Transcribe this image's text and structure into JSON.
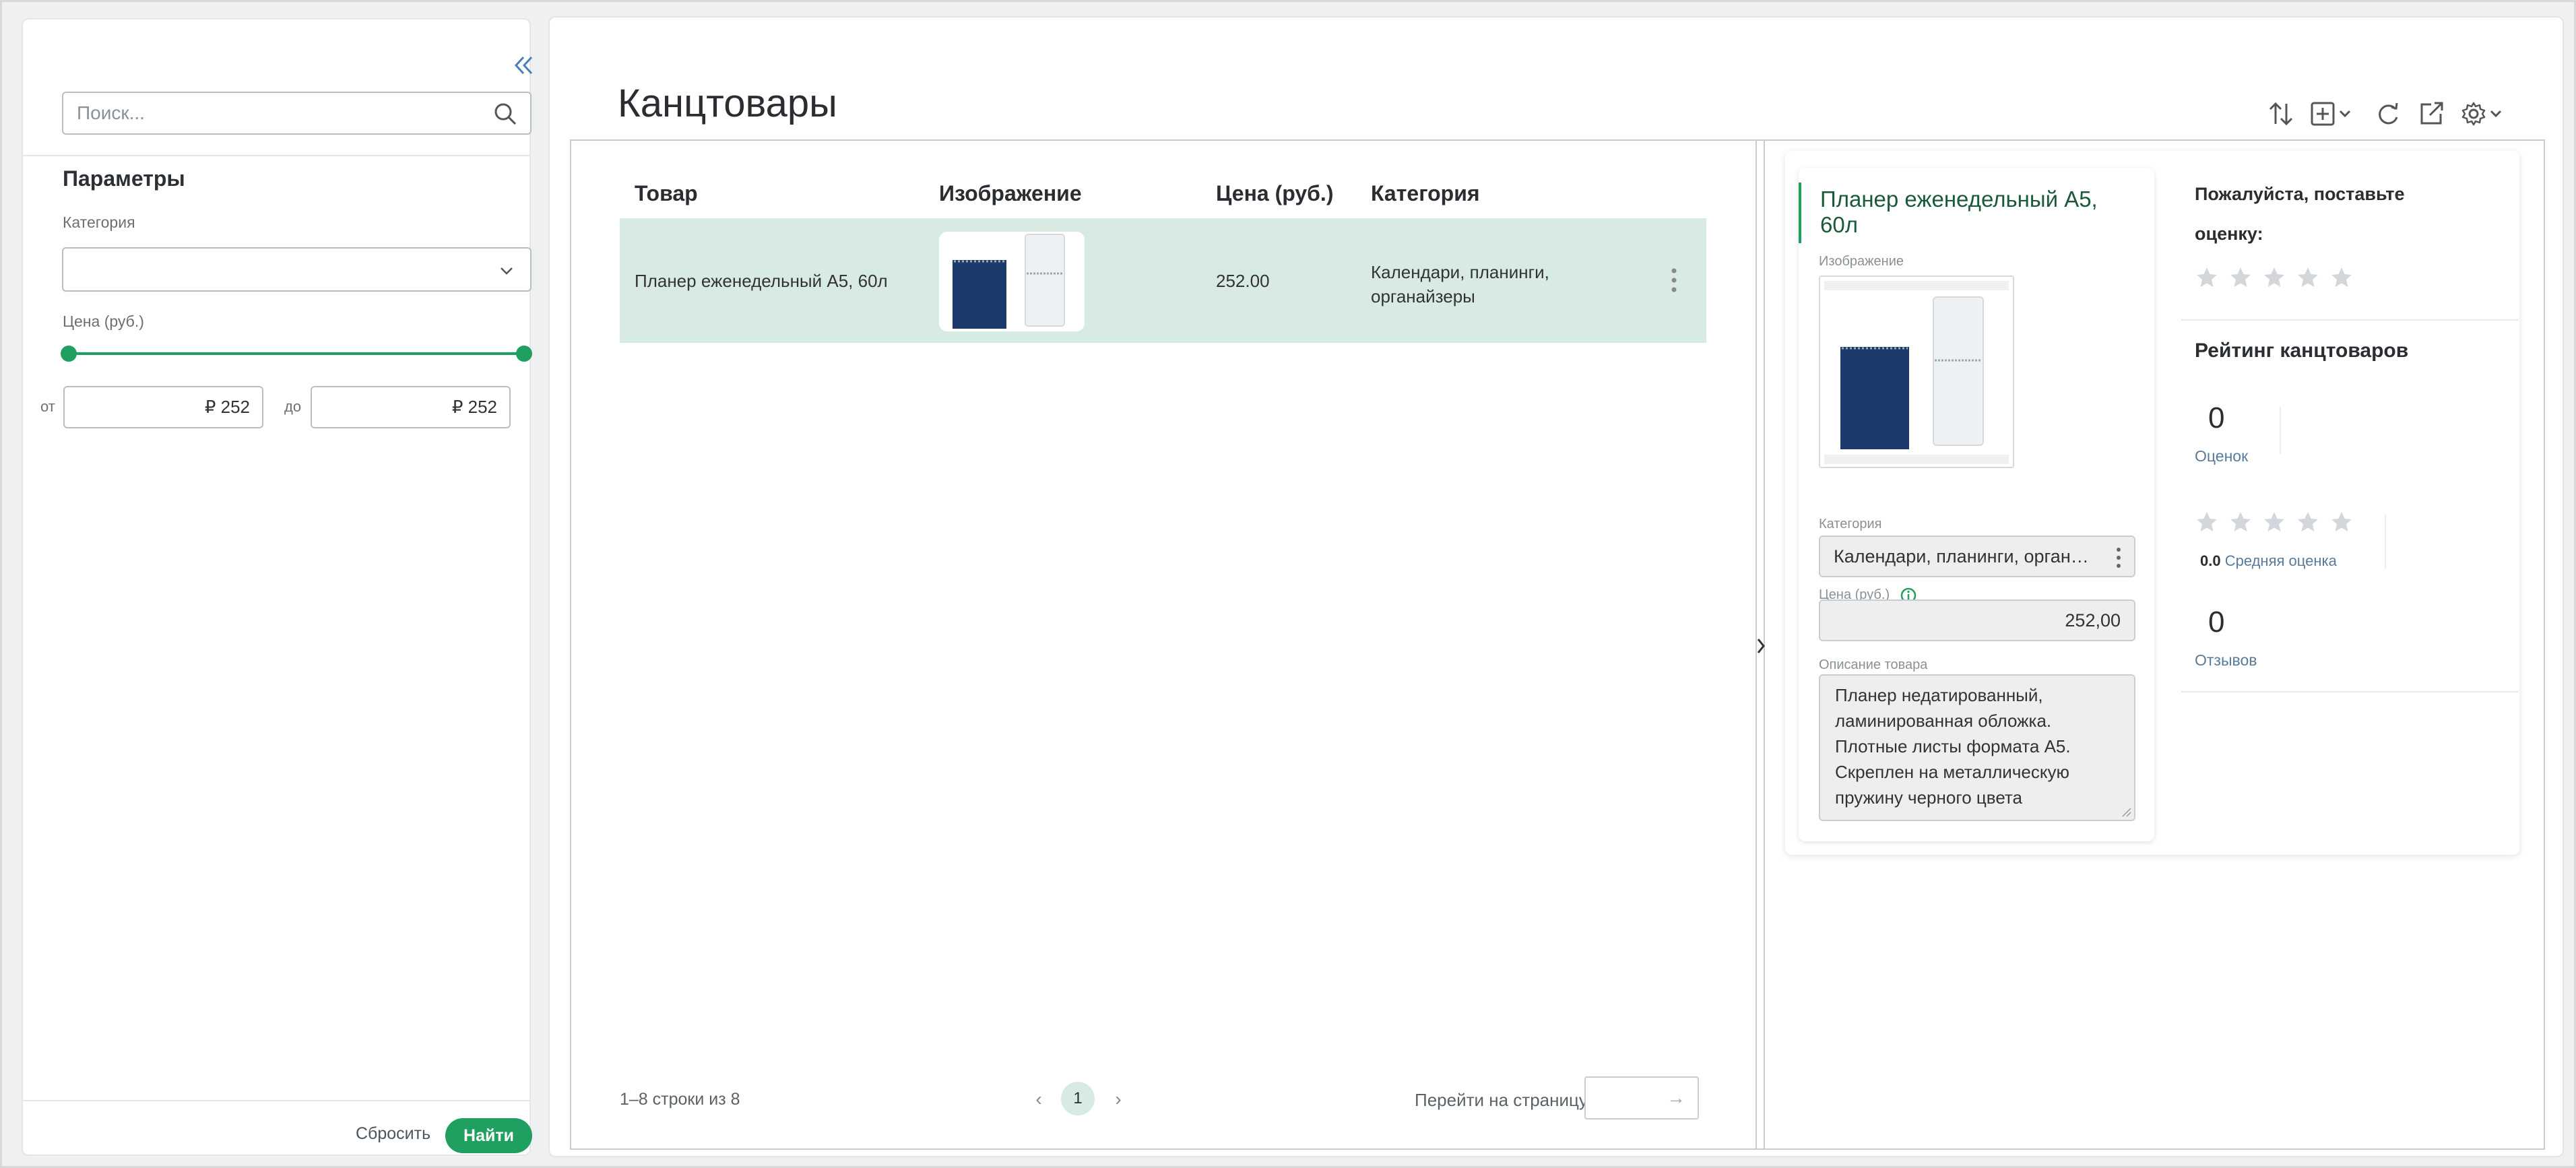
{
  "sidebar": {
    "search_placeholder": "Поиск...",
    "params_title": "Параметры",
    "category_label": "Категория",
    "category_value": "",
    "price_label": "Цена (руб.)",
    "from_prefix": "от",
    "to_prefix": "до",
    "price_from": "₽ 252",
    "price_to": "₽ 252",
    "reset_label": "Сбросить",
    "find_label": "Найти"
  },
  "main": {
    "title": "Канцтовары",
    "toolbar_icons": [
      "sort-icon",
      "add-icon",
      "refresh-icon",
      "export-icon",
      "settings-icon"
    ]
  },
  "grid": {
    "columns": [
      "Товар",
      "Изображение",
      "Цена (руб.)",
      "Категория"
    ],
    "rows": [
      {
        "product": "Планер еженедельный А5, 60л",
        "price": "252.00",
        "category": "Календари, планинги, органайзеры"
      }
    ],
    "footer": {
      "rows_info": "1–8 строки из 8",
      "current_page": "1",
      "goto_label": "Перейти на страницу",
      "goto_value": ""
    }
  },
  "detail": {
    "title": "Планер еженедельный А5, 60л",
    "image_label": "Изображение",
    "category_label": "Категория",
    "category_value": "Календари, планинги, органайзеры",
    "price_label": "Цена (руб.)",
    "price_value": "252,00",
    "description_label": "Описание товара",
    "description": "Планер недатированный, ламинированная обложка. Плотные листы формата А5. Скреплен на металлическую пружину черного цвета"
  },
  "rating": {
    "prompt": "Пожалуйста, поставьте оценку:",
    "title": "Рейтинг канцтоваров",
    "ratings_count": "0",
    "ratings_label": "Оценок",
    "average_value": "0.0",
    "average_label": "Средняя оценка",
    "reviews_count": "0",
    "reviews_label": "Отзывов",
    "user_stars": 0,
    "avg_stars": 0
  },
  "colors": {
    "accent": "#1fa060",
    "selected_row": "#d8ebe2",
    "star_empty": "#d3d7db"
  }
}
